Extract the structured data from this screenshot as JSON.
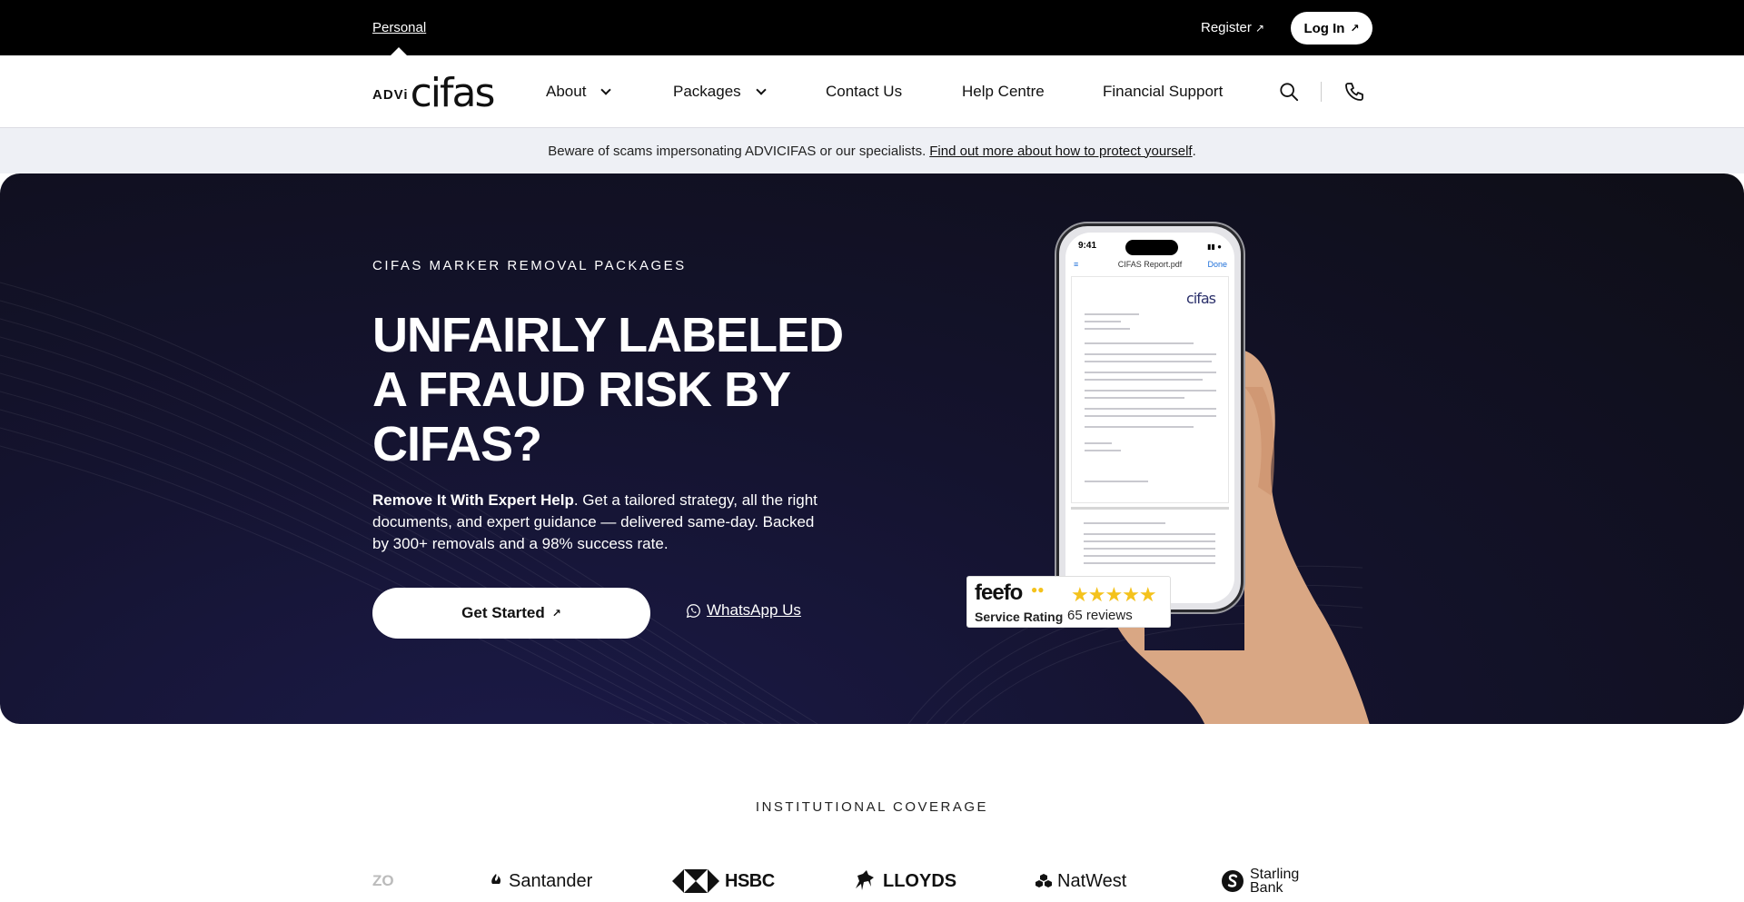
{
  "topbar": {
    "personal": "Personal",
    "register": "Register",
    "login": "Log In"
  },
  "nav": {
    "logo_small": "ADVi",
    "logo_big": "cifas",
    "items": [
      {
        "label": "About"
      },
      {
        "label": "Packages"
      },
      {
        "label": "Contact Us"
      },
      {
        "label": "Help Centre"
      },
      {
        "label": "Financial Support"
      }
    ],
    "icons": [
      "search-icon",
      "phone-icon"
    ]
  },
  "banner": {
    "text": "Beware of scams impersonating ADVICIFAS or our specialists.",
    "link": "Find out more about how to protect yourself",
    "suffix": "."
  },
  "hero": {
    "eyebrow": "CIFAS MARKER REMOVAL PACKAGES",
    "headline": "UNFAIRLY LABELED A FRAUD RISK BY CIFAS?",
    "lede_bold": "Remove It With Expert Help",
    "lede_rest": ". Get a tailored strategy, all the right documents, and expert guidance — delivered same-day. Backed by 300+ removals and a 98% success rate.",
    "cta_primary": "Get Started",
    "cta_secondary": "WhatsApp Us",
    "phone": {
      "time": "9:41",
      "doc_title": "CIFAS Report.pdf",
      "done": "Done",
      "doc_logo": "cifas"
    }
  },
  "feefo": {
    "brand": "feefo",
    "label": "Service Rating",
    "rating": 5,
    "reviews": "65 reviews"
  },
  "institutional": {
    "title": "INSTITUTIONAL COVERAGE",
    "banks": [
      "ZO",
      "Santander",
      "HSBC",
      "LLOYDS",
      "NatWest",
      "Starling Bank"
    ]
  },
  "colors": {
    "topbar_bg": "#000000",
    "banner_bg": "#eef0f5",
    "hero_dark": "#14132e",
    "accent_star": "#f4c21c"
  }
}
